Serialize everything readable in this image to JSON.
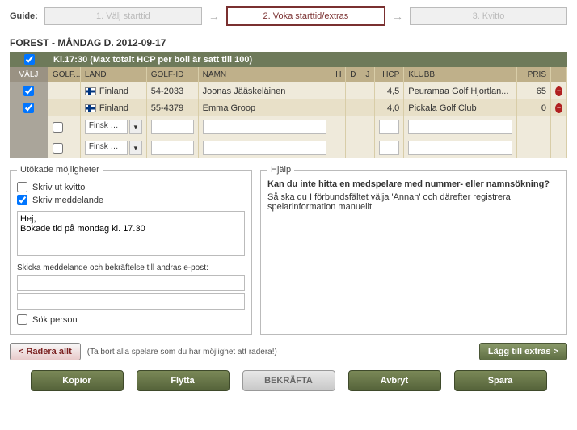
{
  "guide": {
    "label": "Guide:",
    "step1": "1. Välj starttid",
    "step2": "2. Voka starttid/extras",
    "step3": "3. Kvitto"
  },
  "forest_title": "FOREST - MÅNDAG D. 2012-09-17",
  "booking_header": "Kl.17:30 (Max totalt HCP per boll är satt till 100)",
  "columns": {
    "valj": "VÄLJ",
    "golf": "GOLF...",
    "land": "LAND",
    "id": "GOLF-ID",
    "namn": "NAMN",
    "h": "H",
    "d": "D",
    "j": "J",
    "hcp": "HCP",
    "klubb": "KLUBB",
    "pris": "PRIS"
  },
  "rows": [
    {
      "land": "Finland",
      "id": "54-2033",
      "namn": "Joonas Jääskeläinen",
      "hcp": "4,5",
      "klubb": "Peuramaa Golf Hjortlan...",
      "pris": "65"
    },
    {
      "land": "Finland",
      "id": "55-4379",
      "namn": "Emma Groop",
      "hcp": "4,0",
      "klubb": "Pickala Golf Club",
      "pris": "0"
    }
  ],
  "empty_rows": [
    {
      "dd": "Finsk m..."
    },
    {
      "dd": "Finsk m..."
    }
  ],
  "extended": {
    "legend": "Utökade möjligheter",
    "skriv_kvitto": "Skriv ut kvitto",
    "skriv_medd": "Skriv meddelande",
    "message": "Hej,\nBokade tid på mondag kl. 17.30",
    "send_label": "Skicka meddelande och bekräftelse till andras e-post:",
    "sok_person": "Sök person"
  },
  "help": {
    "legend": "Hjälp",
    "title": "Kan du inte hitta en medspelare med nummer- eller namnsökning?",
    "body": "Så ska du I förbundsfältet välja 'Annan' och därefter registrera spelarinformation manuellt."
  },
  "actions": {
    "radera": "< Radera allt",
    "radera_hint": "(Ta bort alla spelare som du har möjlighet att radera!)",
    "lagg_till": "Lägg till extras >"
  },
  "bottom": {
    "kopior": "Kopior",
    "flytta": "Flytta",
    "bekrafta": "BEKRÄFTA",
    "avbryt": "Avbryt",
    "spara": "Spara"
  }
}
